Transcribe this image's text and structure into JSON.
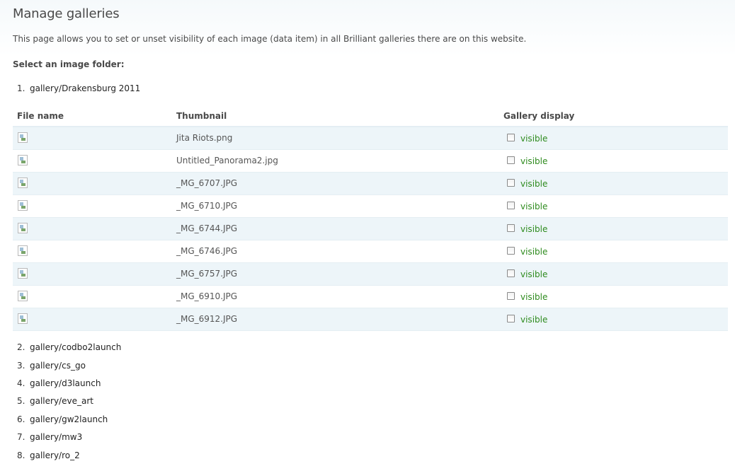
{
  "page": {
    "title": "Manage galleries",
    "description": "This page allows you to set or unset visibility of each image (data item) in all Brilliant galleries there are on this website.",
    "folder_label": "Select an image folder:"
  },
  "folders": [
    {
      "num": "1.",
      "name": "gallery/Drakensburg 2011"
    },
    {
      "num": "2.",
      "name": "gallery/codbo2launch"
    },
    {
      "num": "3.",
      "name": "gallery/cs_go"
    },
    {
      "num": "4.",
      "name": "gallery/d3launch"
    },
    {
      "num": "5.",
      "name": "gallery/eve_art"
    },
    {
      "num": "6.",
      "name": "gallery/gw2launch"
    },
    {
      "num": "7.",
      "name": "gallery/mw3"
    },
    {
      "num": "8.",
      "name": "gallery/ro_2"
    }
  ],
  "table": {
    "headers": {
      "file_name": "File name",
      "thumbnail": "Thumbnail",
      "gallery_display": "Gallery display"
    },
    "rows": [
      {
        "file": "Jita Riots.png",
        "visible_label": "visible",
        "checked": false
      },
      {
        "file": "Untitled_Panorama2.jpg",
        "visible_label": "visible",
        "checked": false
      },
      {
        "file": "_MG_6707.JPG",
        "visible_label": "visible",
        "checked": false
      },
      {
        "file": "_MG_6710.JPG",
        "visible_label": "visible",
        "checked": false
      },
      {
        "file": "_MG_6744.JPG",
        "visible_label": "visible",
        "checked": false
      },
      {
        "file": "_MG_6746.JPG",
        "visible_label": "visible",
        "checked": false
      },
      {
        "file": "_MG_6757.JPG",
        "visible_label": "visible",
        "checked": false
      },
      {
        "file": "_MG_6910.JPG",
        "visible_label": "visible",
        "checked": false
      },
      {
        "file": "_MG_6912.JPG",
        "visible_label": "visible",
        "checked": false
      }
    ]
  },
  "colors": {
    "row_alt": "#edf5f9",
    "visible_text": "#2e8b1e"
  },
  "icons": {
    "thumbnail": "broken-image-icon"
  }
}
